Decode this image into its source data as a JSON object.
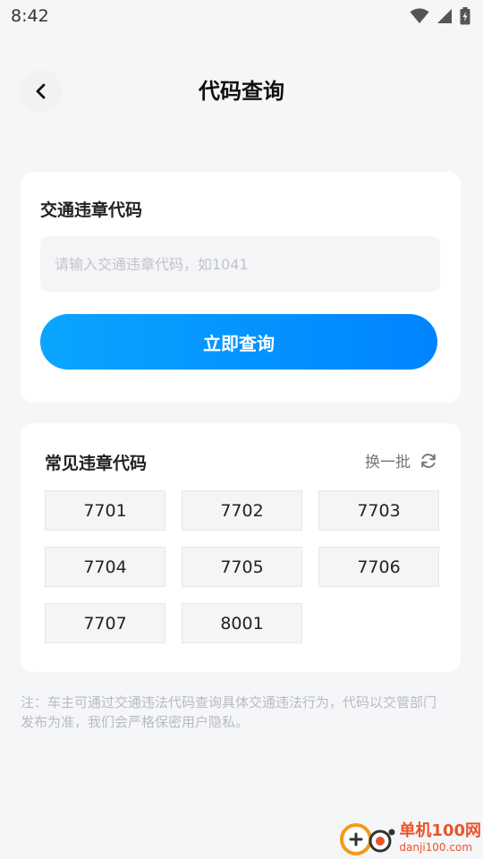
{
  "status_bar": {
    "time": "8:42"
  },
  "header": {
    "title": "代码查询"
  },
  "query": {
    "label": "交通违章代码",
    "input_value": "",
    "placeholder": "请输入交通违章代码，如1041",
    "submit_label": "立即查询"
  },
  "common_codes": {
    "title": "常见违章代码",
    "refresh_label": "换一批",
    "codes": [
      "7701",
      "7702",
      "7703",
      "7704",
      "7705",
      "7706",
      "7707",
      "8001"
    ]
  },
  "note": "注：车主可通过交通违法代码查询具体交通违法行为，代码以交管部门发布为准，我们会严格保密用户隐私。",
  "watermark": {
    "name": "单机100网",
    "url": "danji100.com"
  },
  "colors": {
    "accent_start": "#0aa5ff",
    "accent_end": "#0084ff",
    "background": "#f5f6f8",
    "watermark": "#e8542b"
  },
  "icons": [
    "wifi-icon",
    "signal-icon",
    "battery-icon",
    "back-chevron-icon",
    "refresh-icon"
  ]
}
